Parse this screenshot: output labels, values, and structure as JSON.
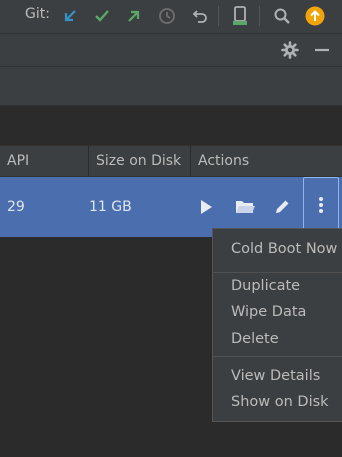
{
  "toolbar": {
    "git_label": "Git:",
    "icons": [
      "update-project-icon",
      "commit-icon",
      "push-icon",
      "history-icon",
      "rollback-icon",
      "device-icon",
      "search-icon",
      "update-available-icon"
    ]
  },
  "table": {
    "headers": {
      "api": "API",
      "size": "Size on Disk",
      "actions": "Actions"
    },
    "row": {
      "api": "29",
      "size": "11 GB"
    }
  },
  "menu": {
    "cold_boot": "Cold Boot Now",
    "duplicate": "Duplicate",
    "wipe": "Wipe Data",
    "delete": "Delete",
    "view_details": "View Details",
    "show_on_disk": "Show on Disk"
  },
  "colors": {
    "selection": "#4b6eaf",
    "vcs_blue": "#3592c4",
    "vcs_green": "#59a869",
    "update_orange": "#f0a30a"
  }
}
